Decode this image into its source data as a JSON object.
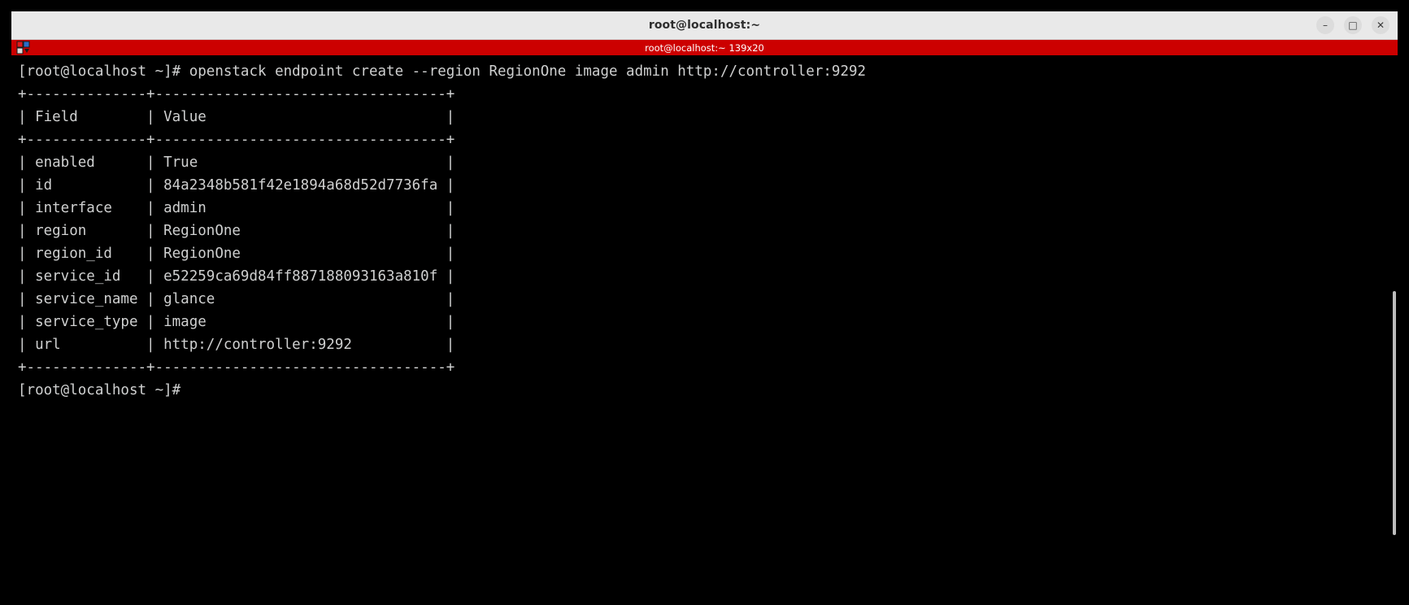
{
  "window": {
    "title": "root@localhost:~",
    "controls": [
      {
        "name": "minimize-button",
        "glyph": "–"
      },
      {
        "name": "maximize-button",
        "glyph": "□"
      },
      {
        "name": "close-button",
        "glyph": "✕"
      }
    ]
  },
  "tabbar": {
    "menu_icon": "color-grid-dropdown-icon",
    "label": "root@localhost:~ 139x20",
    "background": "#cc0000"
  },
  "terminal": {
    "background": "#000000",
    "foreground": "#cfd0d0",
    "columns": 139,
    "rows": 20,
    "prompt": "[root@localhost ~]#",
    "command": "openstack endpoint create --region RegionOne image admin http://controller:9292",
    "table": {
      "headers": [
        "Field",
        "Value"
      ],
      "rows": [
        {
          "field": "enabled",
          "value": "True"
        },
        {
          "field": "id",
          "value": "84a2348b581f42e1894a68d52d7736fa"
        },
        {
          "field": "interface",
          "value": "admin"
        },
        {
          "field": "region",
          "value": "RegionOne"
        },
        {
          "field": "region_id",
          "value": "RegionOne"
        },
        {
          "field": "service_id",
          "value": "e52259ca69d84ff887188093163a810f"
        },
        {
          "field": "service_name",
          "value": "glance"
        },
        {
          "field": "service_type",
          "value": "image"
        },
        {
          "field": "url",
          "value": "http://controller:9292"
        }
      ]
    },
    "lines": [
      "[root@localhost ~]# openstack endpoint create --region RegionOne image admin http://controller:9292",
      "+--------------+----------------------------------+",
      "| Field        | Value                            |",
      "+--------------+----------------------------------+",
      "| enabled      | True                             |",
      "| id           | 84a2348b581f42e1894a68d52d7736fa |",
      "| interface    | admin                            |",
      "| region       | RegionOne                        |",
      "| region_id    | RegionOne                        |",
      "| service_id   | e52259ca69d84ff887188093163a810f |",
      "| service_name | glance                           |",
      "| service_type | image                            |",
      "| url          | http://controller:9292           |",
      "+--------------+----------------------------------+",
      "[root@localhost ~]#"
    ]
  }
}
